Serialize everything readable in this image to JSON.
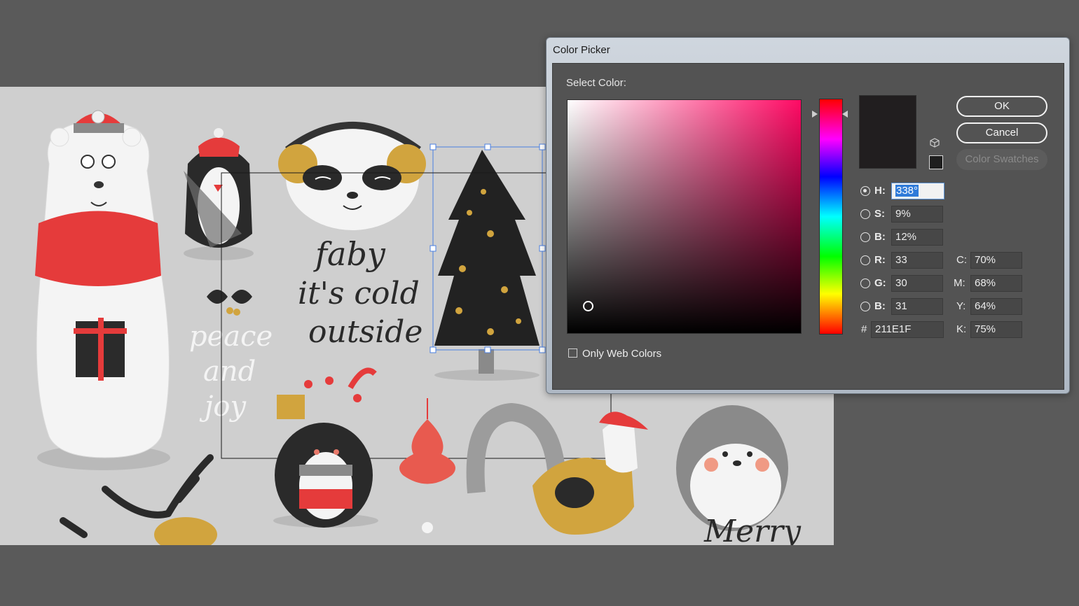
{
  "dialog": {
    "title": "Color Picker",
    "select_label": "Select Color:",
    "swatch_color": "#211E1F",
    "buttons": {
      "ok": "OK",
      "cancel": "Cancel",
      "swatches": "Color Swatches"
    },
    "only_web_colors": "Only Web Colors",
    "only_web_colors_checked": false,
    "fields": {
      "H": "338°",
      "S": "9%",
      "B": "12%",
      "R": "33",
      "G": "30",
      "B2": "31",
      "hex": "211E1F",
      "C": "70%",
      "M": "68%",
      "Y": "64%",
      "K": "75%"
    },
    "labels": {
      "H": "H:",
      "S": "S:",
      "B": "B:",
      "R": "R:",
      "G": "G:",
      "B2": "B:",
      "hash": "#",
      "C": "C:",
      "M": "M:",
      "Y": "Y:",
      "K": "K:"
    },
    "selected_mode": "H"
  },
  "artboard": {
    "lettering": {
      "line1": "faby",
      "line2": "it's cold",
      "line3": "outside",
      "peace1": "peace",
      "peace2": "and",
      "peace3": "joy",
      "merry": "Merry"
    }
  }
}
